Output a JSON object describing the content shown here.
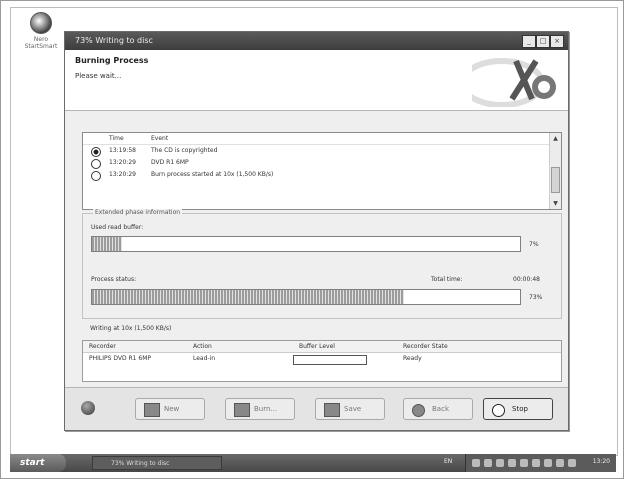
{
  "desktop": {
    "icon_label": "Nero StartSmart"
  },
  "window": {
    "title": "73% Writing to disc",
    "heading": "Burning Process",
    "subheading": "Please wait..."
  },
  "events": {
    "columns": [
      "Time",
      "Event"
    ],
    "rows": [
      {
        "time": "13:19:58",
        "event": "The CD is copyrighted",
        "icon": "info-dark-icon"
      },
      {
        "time": "13:20:29",
        "event": "DVD R1 6MP",
        "icon": "info-icon"
      },
      {
        "time": "13:20:29",
        "event": "Burn process started at 10x (1,500 KB/s)",
        "icon": "info-icon"
      }
    ]
  },
  "extended": {
    "legend": "Extended phase information",
    "buffer_label": "Used read buffer:",
    "buffer_percent": 7,
    "buffer_text": "7%",
    "process_label": "Process status:",
    "total_time_label": "Total time:",
    "total_time": "00:00:48",
    "process_percent": 73,
    "process_text": "73%"
  },
  "status_line": "Writing at 10x (1,500 KB/s)",
  "recorders": {
    "columns": [
      "Recorder",
      "Action",
      "Buffer Level",
      "Recorder State"
    ],
    "row": {
      "recorder": "PHILIPS DVD R1 6MP",
      "action": "Lead-in",
      "buffer_level": "",
      "state": "Ready"
    }
  },
  "buttons": {
    "new": "New",
    "burn": "Burn...",
    "save": "Save",
    "back": "Back",
    "stop": "Stop"
  },
  "taskbar": {
    "start": "start",
    "task": "73% Writing to disc",
    "lang": "EN",
    "clock": "13:20"
  }
}
